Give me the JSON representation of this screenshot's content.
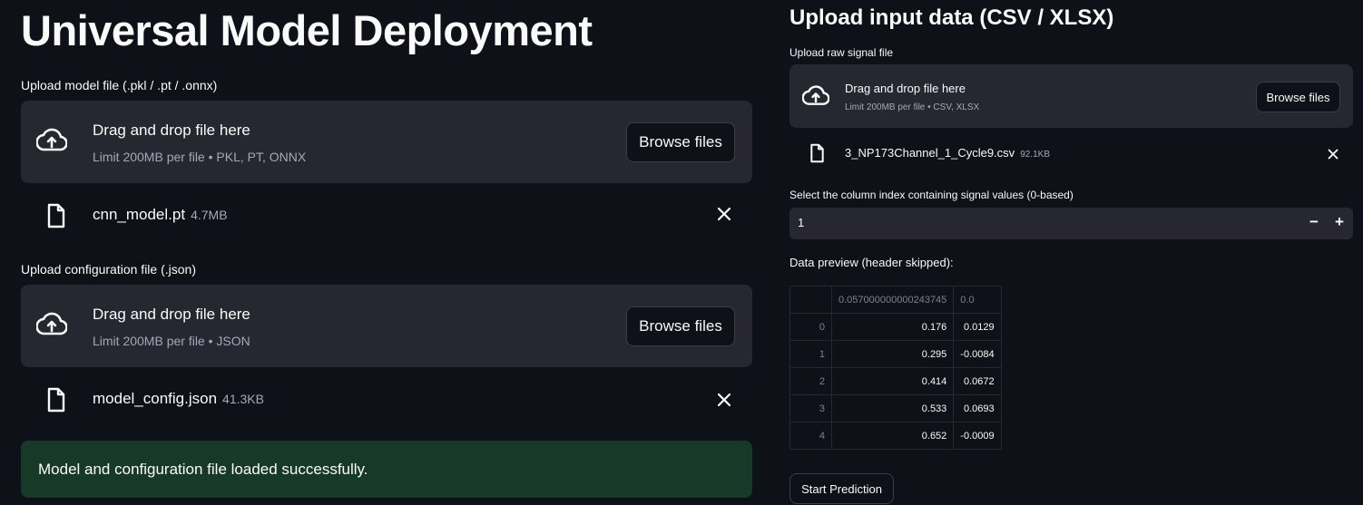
{
  "left": {
    "title": "Universal Model Deployment",
    "model_upload": {
      "label": "Upload model file (.pkl / .pt / .onnx)",
      "drop_title": "Drag and drop file here",
      "drop_sub": "Limit 200MB per file • PKL, PT, ONNX",
      "browse_label": "Browse files",
      "file_name": "cnn_model.pt",
      "file_size": "4.7MB"
    },
    "config_upload": {
      "label": "Upload configuration file (.json)",
      "drop_title": "Drag and drop file here",
      "drop_sub": "Limit 200MB per file • JSON",
      "browse_label": "Browse files",
      "file_name": "model_config.json",
      "file_size": "41.3KB"
    },
    "success_message": "Model and configuration file loaded successfully."
  },
  "right": {
    "title": "Upload input data (CSV / XLSX)",
    "signal_upload": {
      "label": "Upload raw signal file",
      "drop_title": "Drag and drop file here",
      "drop_sub": "Limit 200MB per file • CSV, XLSX",
      "browse_label": "Browse files",
      "file_name": "3_NP173Channel_1_Cycle9.csv",
      "file_size": "92.1KB"
    },
    "column_select": {
      "label": "Select the column index containing signal values (0-based)",
      "value": "1",
      "minus": "−",
      "plus": "+"
    },
    "preview": {
      "label": "Data preview (header skipped):",
      "columns": [
        "",
        "0.057000000000243745",
        "0.0"
      ],
      "rows": [
        [
          "0",
          "0.176",
          "0.0129"
        ],
        [
          "1",
          "0.295",
          "-0.0084"
        ],
        [
          "2",
          "0.414",
          "0.0672"
        ],
        [
          "3",
          "0.533",
          "0.0693"
        ],
        [
          "4",
          "0.652",
          "-0.0009"
        ]
      ]
    },
    "start_button": "Start Prediction"
  },
  "icons": {
    "upload": "cloud-upload-icon",
    "file": "file-icon",
    "close": "close-icon"
  },
  "colors": {
    "background": "#0e1117",
    "panel": "#262730",
    "success_bg": "#173928",
    "muted_text": "#a3a8b8"
  }
}
